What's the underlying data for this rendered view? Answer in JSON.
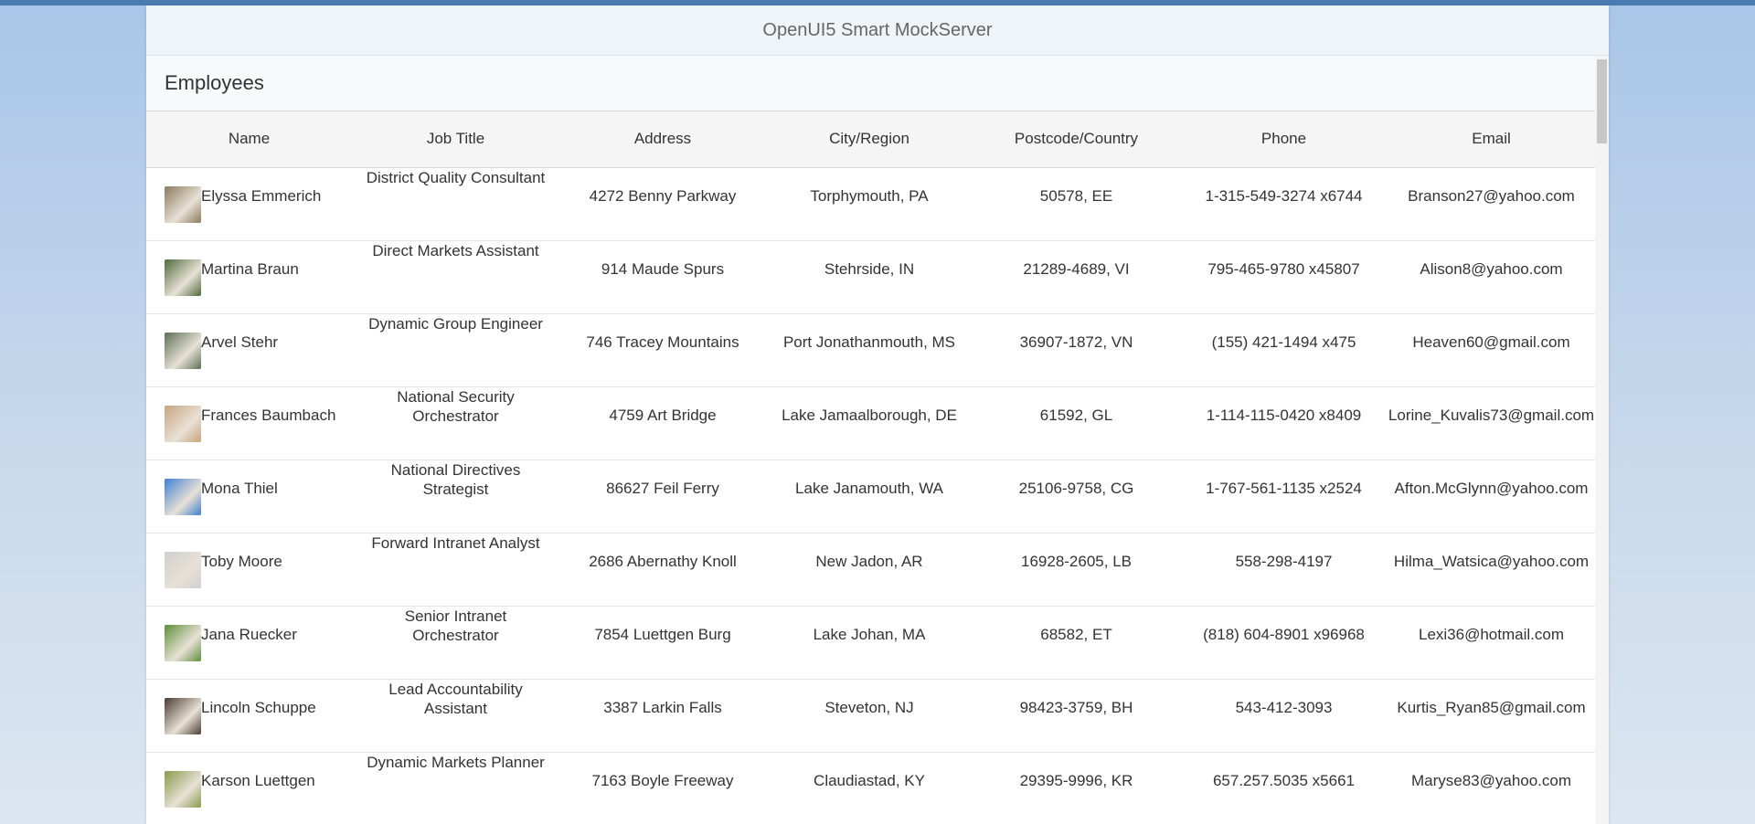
{
  "app": {
    "title": "OpenUI5 Smart MockServer"
  },
  "panel": {
    "title": "Employees"
  },
  "table": {
    "columns": [
      "Name",
      "Job Title",
      "Address",
      "City/Region",
      "Postcode/Country",
      "Phone",
      "Email"
    ],
    "rows": [
      {
        "name": "Elyssa Emmerich",
        "job": "District Quality Consultant",
        "address": "4272 Benny Parkway",
        "city": "Torphymouth, PA",
        "postcode": "50578, EE",
        "phone": "1-315-549-3274 x6744",
        "email": "Branson27@yahoo.com",
        "avatar_color": "#8a7a5c"
      },
      {
        "name": "Martina Braun",
        "job": "Direct Markets Assistant",
        "address": "914 Maude Spurs",
        "city": "Stehrside, IN",
        "postcode": "21289-4689, VI",
        "phone": "795-465-9780 x45807",
        "email": "Alison8@yahoo.com",
        "avatar_color": "#4f6b3a"
      },
      {
        "name": "Arvel Stehr",
        "job": "Dynamic Group Engineer",
        "address": "746 Tracey Mountains",
        "city": "Port Jonathanmouth, MS",
        "postcode": "36907-1872, VN",
        "phone": "(155) 421-1494 x475",
        "email": "Heaven60@gmail.com",
        "avatar_color": "#5a6e55"
      },
      {
        "name": "Frances Baumbach",
        "job": "National Security Orchestrator",
        "address": "4759 Art Bridge",
        "city": "Lake Jamaalborough, DE",
        "postcode": "61592, GL",
        "phone": "1-114-115-0420 x8409",
        "email": "Lorine_Kuvalis73@gmail.com",
        "avatar_color": "#c9a37e"
      },
      {
        "name": "Mona Thiel",
        "job": "National Directives Strategist",
        "address": "86627 Feil Ferry",
        "city": "Lake Janamouth, WA",
        "postcode": "25106-9758, CG",
        "phone": "1-767-561-1135 x2524",
        "email": "Afton.McGlynn@yahoo.com",
        "avatar_color": "#3f7fd0"
      },
      {
        "name": "Toby Moore",
        "job": "Forward Intranet Analyst",
        "address": "2686 Abernathy Knoll",
        "city": "New Jadon, AR",
        "postcode": "16928-2605, LB",
        "phone": "558-298-4197",
        "email": "Hilma_Watsica@yahoo.com",
        "avatar_color": "#cfcfcf"
      },
      {
        "name": "Jana Ruecker",
        "job": "Senior Intranet Orchestrator",
        "address": "7854 Luettgen Burg",
        "city": "Lake Johan, MA",
        "postcode": "68582, ET",
        "phone": "(818) 604-8901 x96968",
        "email": "Lexi36@hotmail.com",
        "avatar_color": "#5d8f3a"
      },
      {
        "name": "Lincoln Schuppe",
        "job": "Lead Accountability Assistant",
        "address": "3387 Larkin Falls",
        "city": "Steveton, NJ",
        "postcode": "98423-3759, BH",
        "phone": "543-412-3093",
        "email": "Kurtis_Ryan85@gmail.com",
        "avatar_color": "#4a3b32"
      },
      {
        "name": "Karson Luettgen",
        "job": "Dynamic Markets Planner",
        "address": "7163 Boyle Freeway",
        "city": "Claudiastad, KY",
        "postcode": "29395-9996, KR",
        "phone": "657.257.5035 x5661",
        "email": "Maryse83@yahoo.com",
        "avatar_color": "#8a9a4a"
      }
    ]
  }
}
